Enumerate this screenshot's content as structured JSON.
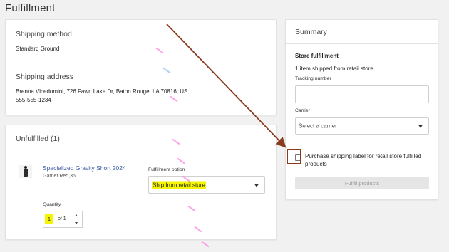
{
  "page": {
    "title": "Fulfillment"
  },
  "shipping_method": {
    "title": "Shipping method",
    "value": "Standard Ground"
  },
  "shipping_address": {
    "title": "Shipping address",
    "line1": "Brenna Vicedomini, 726 Fawn Lake Dr, Baton Rouge, LA 70816, US",
    "phone": "555-555-1234"
  },
  "unfulfilled": {
    "title": "Unfulfilled (1)",
    "product": {
      "name": "Specialized Gravity Short 2024",
      "variant": "Garnet Red,36",
      "fulfillment_option_label": "Fulfillment option",
      "fulfillment_option_value": "Ship from retail store",
      "quantity_label": "Quantity",
      "quantity_value": "1",
      "quantity_of": "of 1"
    }
  },
  "summary": {
    "title": "Summary",
    "store_fulfillment_heading": "Store fulfillment",
    "items_text": "1 item shipped from retail store",
    "tracking_label": "Tracking number",
    "tracking_value": "",
    "carrier_label": "Carrier",
    "carrier_placeholder": "Select a carrier",
    "purchase_label_text": "Purchase shipping label for retail store fulfilled products",
    "purchase_label_checked": false,
    "fulfill_button": "Fulfill products"
  },
  "colors": {
    "highlight": "#f5f500",
    "link": "#3b58a5",
    "callout": "#8a3a1e"
  },
  "icons": [
    "chevron-down-icon",
    "arrow-up-icon",
    "arrow-down-icon",
    "checkbox-icon"
  ]
}
